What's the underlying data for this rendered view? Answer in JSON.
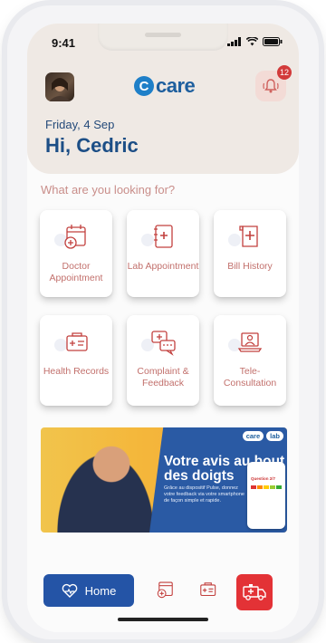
{
  "status": {
    "time": "9:41"
  },
  "header": {
    "logo_text": "care",
    "notification_count": "12",
    "date": "Friday, 4 Sep",
    "greeting": "Hi, Cedric"
  },
  "section_title": "What are you looking for?",
  "services": [
    {
      "label": "Doctor Appointment",
      "icon": "calendar-medical-icon"
    },
    {
      "label": "Lab Appointment",
      "icon": "lab-notebook-icon"
    },
    {
      "label": "Bill History",
      "icon": "bill-document-icon"
    },
    {
      "label": "Health Records",
      "icon": "health-records-icon"
    },
    {
      "label": "Complaint & Feedback",
      "icon": "feedback-chat-icon"
    },
    {
      "label": "Tele-Consultation",
      "icon": "teleconsultation-laptop-icon"
    }
  ],
  "banner": {
    "brand1": "care",
    "brand2": "lab",
    "headline": "Votre avis au bout des doigts",
    "subtext": "Grâce au dispositif Pulse, donnez votre feedback via votre smartphone de façon simple et rapide.",
    "mini_title": "Question 2/7"
  },
  "nav": {
    "home_label": "Home"
  },
  "colors": {
    "primary": "#2454a6",
    "accent": "#c2706c",
    "emergency": "#e33236",
    "header_bg": "#efe9e4"
  }
}
